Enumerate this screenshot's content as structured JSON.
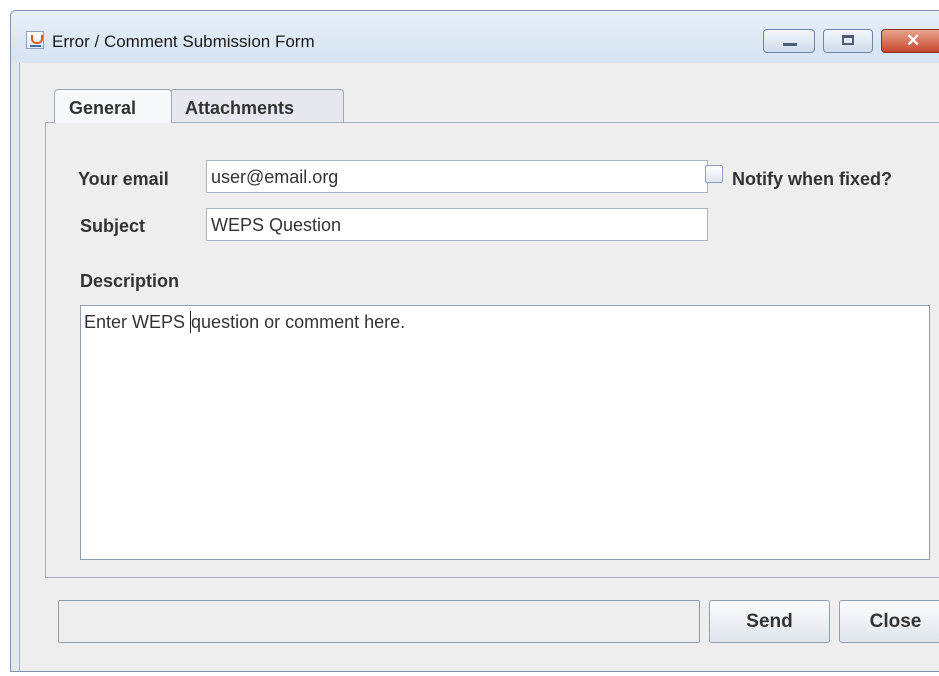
{
  "window": {
    "title": "Error / Comment Submission Form",
    "controls": {
      "minimize": "minimize",
      "maximize": "maximize",
      "close": "close"
    }
  },
  "tabs": [
    {
      "label": "General",
      "selected": true
    },
    {
      "label": "Attachments",
      "selected": false
    }
  ],
  "form": {
    "email_label": "Your email",
    "email_value": "user@email.org",
    "notify_label": "Notify when fixed?",
    "notify_checked": false,
    "subject_label": "Subject",
    "subject_value": "WEPS Question",
    "description_label": "Description",
    "description_before_caret": "Enter WEPS ",
    "description_after_caret": "question or comment here."
  },
  "footer": {
    "status_text": "",
    "send_label": "Send",
    "close_label": "Close"
  }
}
